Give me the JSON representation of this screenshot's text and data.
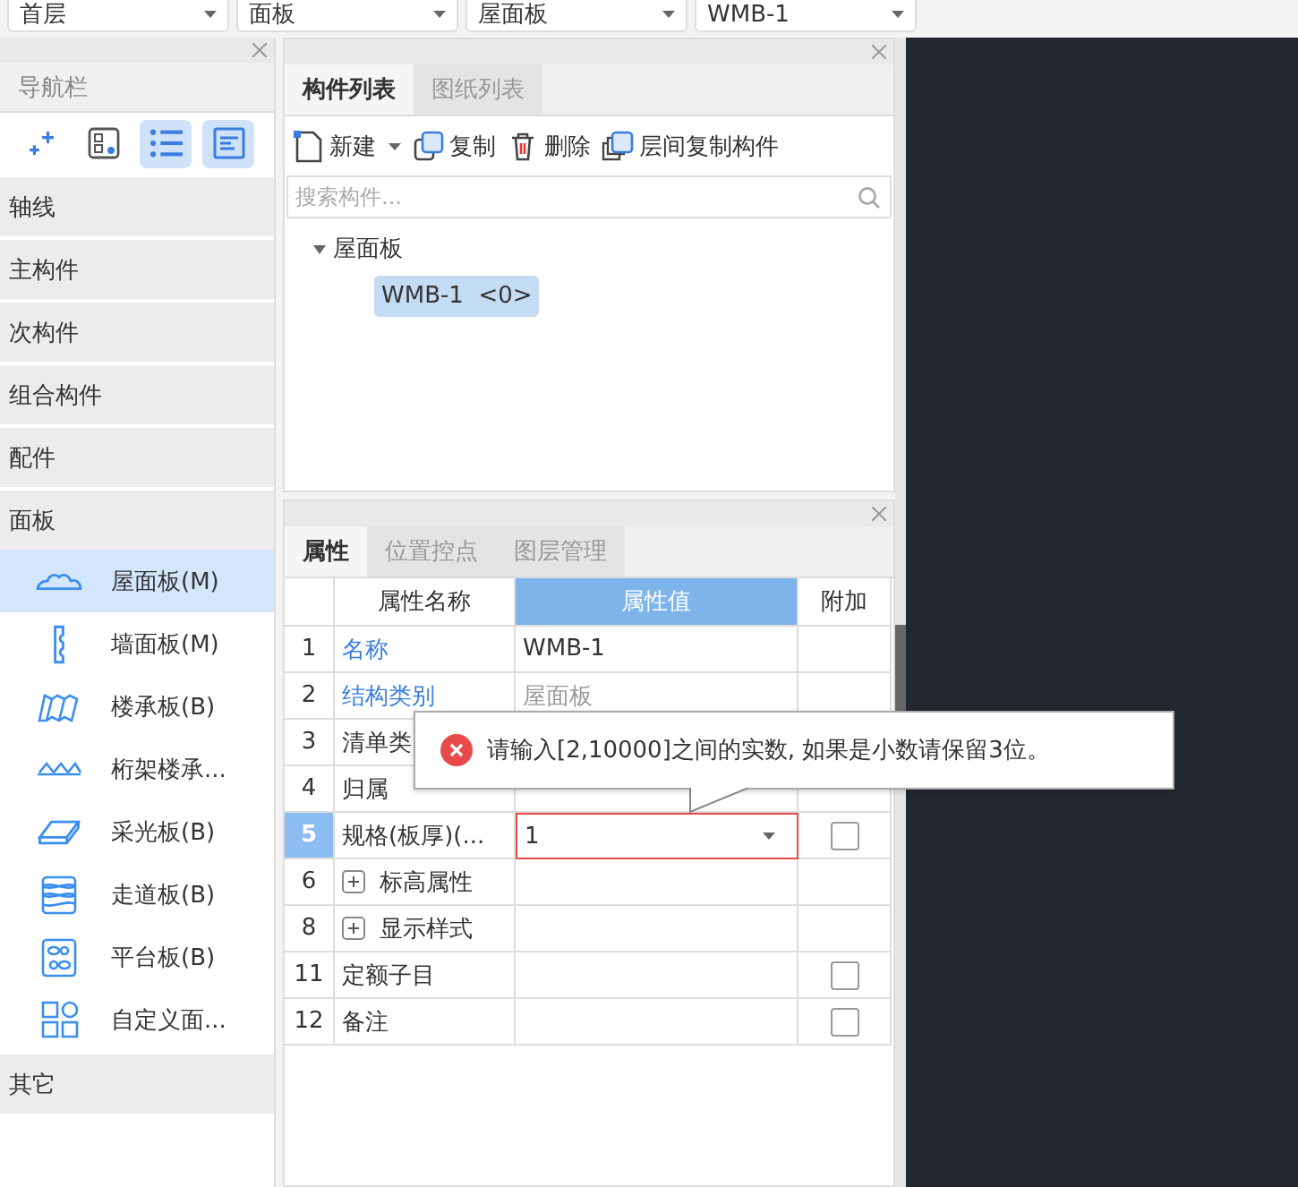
{
  "dropdowns": [
    {
      "value": "首层"
    },
    {
      "value": "面板"
    },
    {
      "value": "屋面板"
    },
    {
      "value": "WMB-1"
    }
  ],
  "nav": {
    "title": "导航栏",
    "tools": [
      {
        "kind": "sparkle",
        "selected": false
      },
      {
        "kind": "grid",
        "selected": false
      },
      {
        "kind": "list",
        "selected": true
      },
      {
        "kind": "form",
        "selected": true
      }
    ],
    "categories": [
      {
        "label": "轴线"
      },
      {
        "label": "主构件"
      },
      {
        "label": "次构件"
      },
      {
        "label": "组合构件"
      },
      {
        "label": "配件"
      },
      {
        "label": "面板",
        "children": [
          {
            "label": "屋面板(M)",
            "kind": "cloud",
            "selected": true
          },
          {
            "label": "墙面板(M)",
            "kind": "wall",
            "selected": false
          },
          {
            "label": "楼承板(B)",
            "kind": "deck",
            "selected": false
          },
          {
            "label": "桁架楼承...",
            "kind": "truss",
            "selected": false
          },
          {
            "label": "采光板(B)",
            "kind": "skylight",
            "selected": false
          },
          {
            "label": "走道板(B)",
            "kind": "mesh",
            "selected": false
          },
          {
            "label": "平台板(B)",
            "kind": "platform",
            "selected": false
          },
          {
            "label": "自定义面...",
            "kind": "custom",
            "selected": false
          }
        ]
      },
      {
        "label": "其它"
      }
    ]
  },
  "component_panel": {
    "tabs": [
      {
        "label": "构件列表",
        "selected": true
      },
      {
        "label": "图纸列表",
        "selected": false
      }
    ],
    "toolbar": [
      {
        "kind": "new",
        "label": "新建",
        "dropdown": true
      },
      {
        "kind": "copy",
        "label": "复制",
        "dropdown": false
      },
      {
        "kind": "delete",
        "label": "删除",
        "dropdown": false
      },
      {
        "kind": "floorcopy",
        "label": "层间复制构件",
        "dropdown": false
      }
    ],
    "search": {
      "placeholder": "搜索构件..."
    },
    "tree": [
      {
        "label": "屋面板",
        "expanded": true,
        "children": [
          {
            "label": "WMB-1  <0>",
            "selected": true
          }
        ]
      }
    ]
  },
  "property_panel": {
    "tabs": [
      {
        "label": "属性",
        "selected": true
      },
      {
        "label": "位置控点",
        "selected": false
      },
      {
        "label": "图层管理",
        "selected": false
      }
    ],
    "columns": [
      {
        "label": "属性名称",
        "selected": false
      },
      {
        "label": "属性值",
        "selected": true
      },
      {
        "label": "附加",
        "selected": false
      }
    ],
    "rows": [
      {
        "num": "1",
        "name": "名称",
        "kind": "link",
        "value": "WMB-1",
        "muted": false,
        "checkbox": false,
        "dropdown": false,
        "selected": false,
        "error": false
      },
      {
        "num": "2",
        "name": "结构类别",
        "kind": "link",
        "value": "屋面板",
        "muted": true,
        "checkbox": false,
        "dropdown": false,
        "selected": false,
        "error": false
      },
      {
        "num": "3",
        "name": "清单类",
        "kind": "plain",
        "selected": false
      },
      {
        "num": "4",
        "name": "归属",
        "kind": "plain",
        "checkbox": false,
        "dropdown": false,
        "selected": false,
        "error": false
      },
      {
        "num": "5",
        "name": "规格(板厚)(...",
        "kind": "plain",
        "value": "1",
        "muted": false,
        "checkbox": true,
        "checked": false,
        "dropdown": true,
        "selected": true,
        "error": true
      },
      {
        "num": "6",
        "name": "标高属性",
        "kind": "group",
        "checkbox": false,
        "dropdown": false,
        "selected": false,
        "error": false
      },
      {
        "num": "8",
        "name": "显示样式",
        "kind": "group",
        "checkbox": false,
        "dropdown": false,
        "selected": false,
        "error": false
      },
      {
        "num": "11",
        "name": "定额子目",
        "kind": "plain",
        "checkbox": true,
        "checked": false,
        "dropdown": false,
        "selected": false,
        "error": false
      },
      {
        "num": "12",
        "name": "备注",
        "kind": "plain",
        "checkbox": true,
        "checked": false,
        "dropdown": false,
        "selected": false,
        "error": false
      }
    ],
    "error_tooltip": {
      "message": "请输入[2,10000]之间的实数, 如果是小数请保留3位。"
    }
  }
}
